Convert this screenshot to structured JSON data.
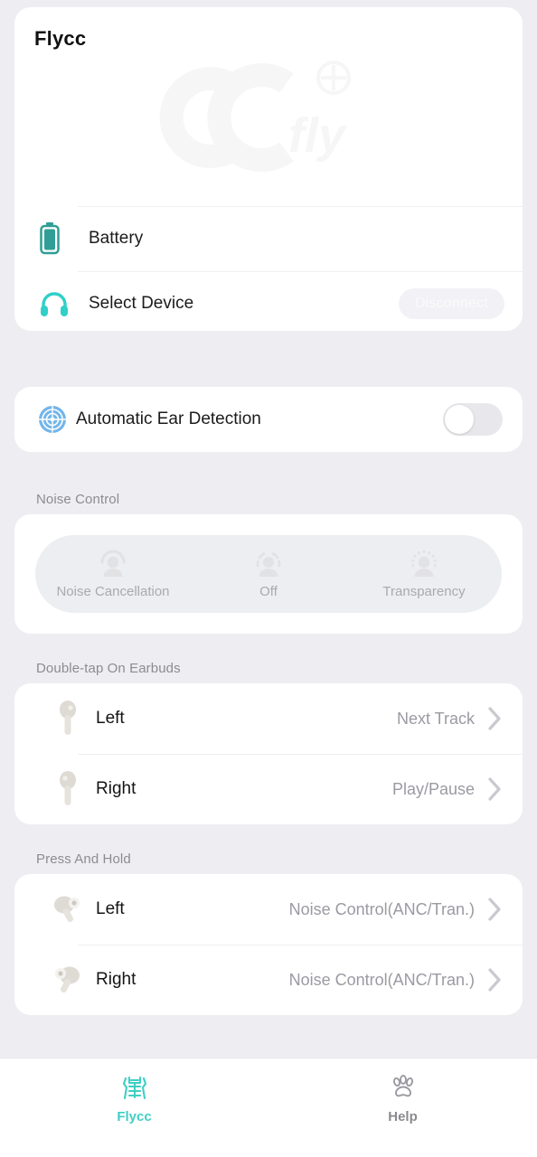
{
  "app": {
    "title": "Flycc",
    "watermark_text": "fly",
    "accent_color": "#3fcfc4",
    "background_color": "#eeeef2",
    "card_color": "#ffffff"
  },
  "header": {
    "battery": {
      "label": "Battery",
      "icon": "battery-icon"
    },
    "device": {
      "label": "Select Device",
      "icon": "headphones-icon",
      "button_label": "Disconnect",
      "button_disabled": true
    }
  },
  "ear_detection": {
    "label": "Automatic Ear Detection",
    "icon": "radar-target-icon",
    "toggle_on": false
  },
  "noise_control": {
    "section_label": "Noise Control",
    "segments": [
      {
        "label": "Noise Cancellation",
        "icon": "head-solid-ring-icon",
        "selected": false
      },
      {
        "label": "Off",
        "icon": "head-dashed-arc-icon",
        "selected": false
      },
      {
        "label": "Transparency",
        "icon": "head-dotted-ring-icon",
        "selected": false
      }
    ]
  },
  "double_tap": {
    "section_label": "Double-tap On Earbuds",
    "rows": [
      {
        "label": "Left",
        "value": "Next Track",
        "icon": "earbud-left-icon"
      },
      {
        "label": "Right",
        "value": "Play/Pause",
        "icon": "earbud-right-icon"
      }
    ]
  },
  "press_and_hold": {
    "section_label": "Press And Hold",
    "rows": [
      {
        "label": "Left",
        "value": "Noise Control(ANC/Tran.)",
        "icon": "earbud-press-left-icon"
      },
      {
        "label": "Right",
        "value": "Noise Control(ANC/Tran.)",
        "icon": "earbud-press-right-icon"
      }
    ]
  },
  "tabbar": {
    "tabs": [
      {
        "label": "Flycc",
        "icon": "flycc-glyph-icon",
        "active": true
      },
      {
        "label": "Help",
        "icon": "paw-print-icon",
        "active": false
      }
    ]
  }
}
